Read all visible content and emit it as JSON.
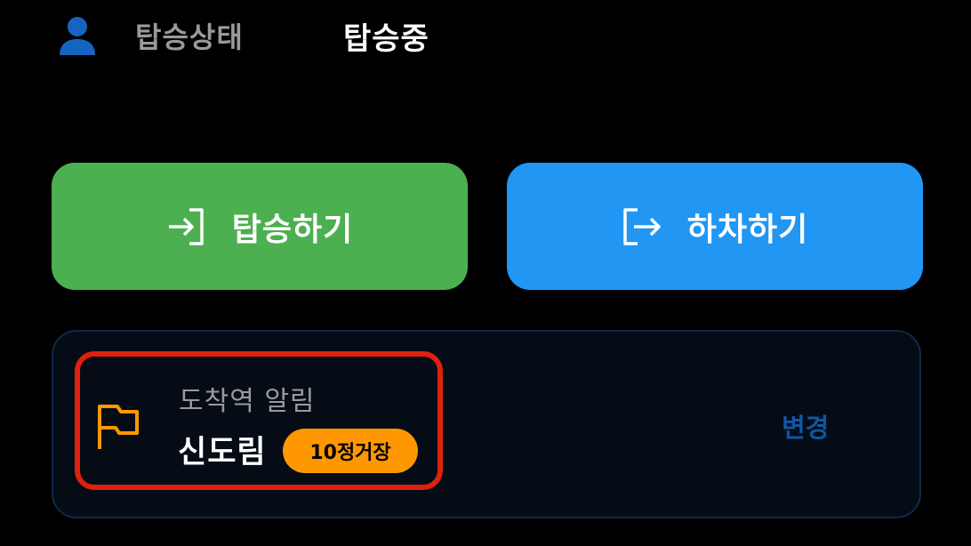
{
  "status": {
    "icon": "person-icon",
    "label": "탑승상태",
    "value": "탑승중"
  },
  "actions": {
    "board": {
      "icon": "login-icon",
      "label": "탑승하기",
      "color": "#4caf50"
    },
    "alight": {
      "icon": "logout-icon",
      "label": "하차하기",
      "color": "#2196f3"
    }
  },
  "arrival_alarm": {
    "icon": "flag-icon",
    "title": "도착역 알림",
    "station": "신도림",
    "stops_badge": "10정거장",
    "change_label": "변경",
    "badge_color": "#ff9800",
    "highlight_color": "#e0200f"
  }
}
